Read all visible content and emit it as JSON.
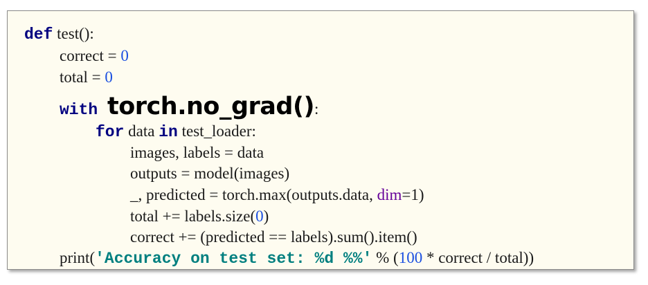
{
  "code": {
    "l1": {
      "kw": "def",
      "rest": " test():"
    },
    "l2": {
      "a": "correct = ",
      "n": "0"
    },
    "l3": {
      "a": "total = ",
      "n": "0"
    },
    "l4": {
      "kw": "with ",
      "big": "torch.no_grad()",
      "rest": ":"
    },
    "l5": {
      "kw1": "for",
      "mid": " data ",
      "kw2": "in",
      "rest": " test_loader:"
    },
    "l6": {
      "a": "images, labels = data"
    },
    "l7": {
      "a": "outputs = model(images)"
    },
    "l8": {
      "a": "_, predicted = torch.max(outputs.data, ",
      "kw": "dim",
      "b": "=1)"
    },
    "l9": {
      "a": "total += labels.size(",
      "n": "0",
      "b": ")"
    },
    "l10": {
      "a": "correct += (predicted == labels).sum().item()"
    },
    "l11": {
      "a": "print(",
      "s": "'Accuracy on test set: %d %%'",
      "b": " % (",
      "n": "100",
      "c": " * correct / total))"
    }
  }
}
